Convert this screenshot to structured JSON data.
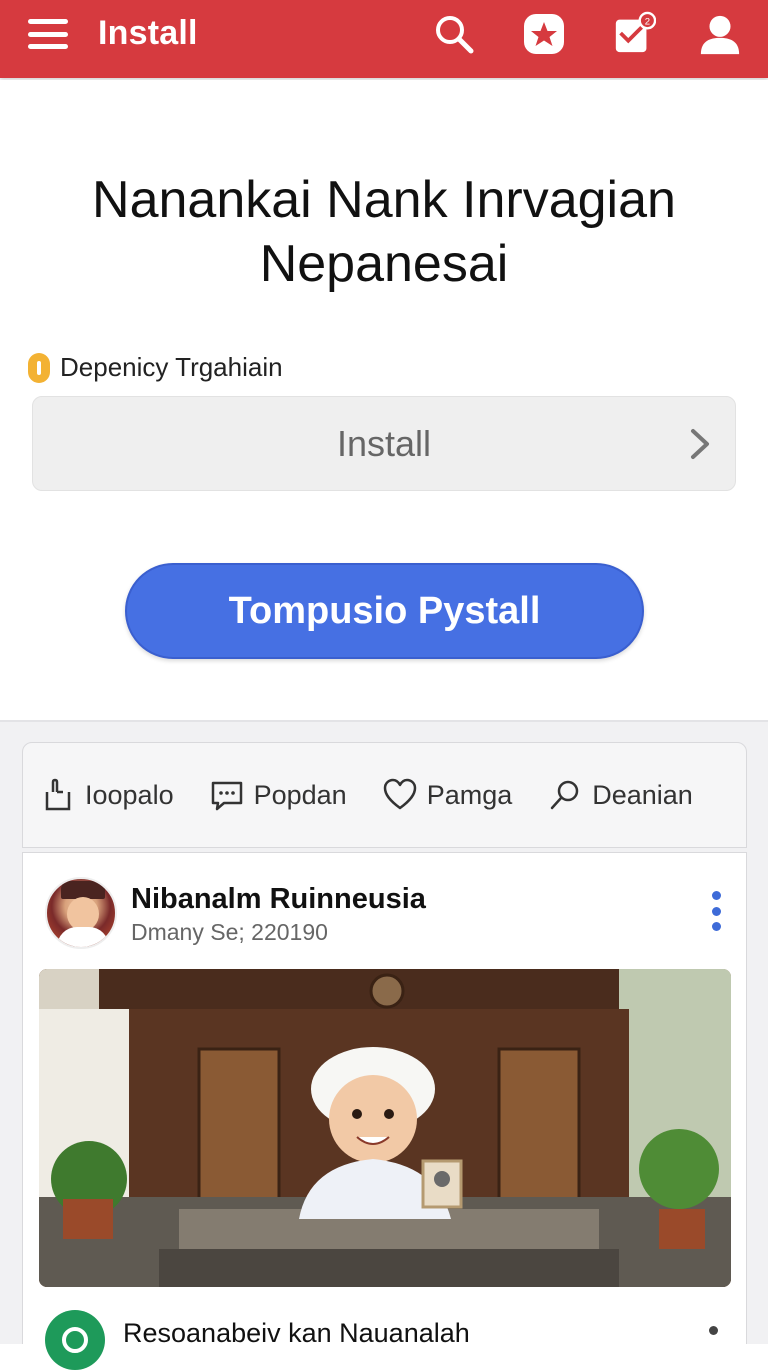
{
  "topbar": {
    "title": "Install",
    "bg_color": "#d63a3f",
    "icons": [
      "menu-icon",
      "search-icon",
      "star-badge-icon",
      "notification-icon",
      "user-icon"
    ],
    "notification_badge": "2"
  },
  "hero": {
    "title": "Nanankai Nank Inrvagian Nepanesai",
    "dependency_label": "Depenicy Trgahiain",
    "select_value": "Install",
    "primary_button": "Tompusio  Pystall",
    "accent_color": "#4670e3"
  },
  "actions": [
    {
      "label": "Ioopalo",
      "icon": "share-icon"
    },
    {
      "label": "Popdan",
      "icon": "comment-icon"
    },
    {
      "label": "Pamga",
      "icon": "heart-icon"
    },
    {
      "label": "Deanian",
      "icon": "search-icon"
    }
  ],
  "post": {
    "author": "Nibanalm Ruinneusia",
    "date": "Dmany Se; 220190"
  },
  "next_post": {
    "title": "Resoanabeiv kan Nauanalah"
  }
}
